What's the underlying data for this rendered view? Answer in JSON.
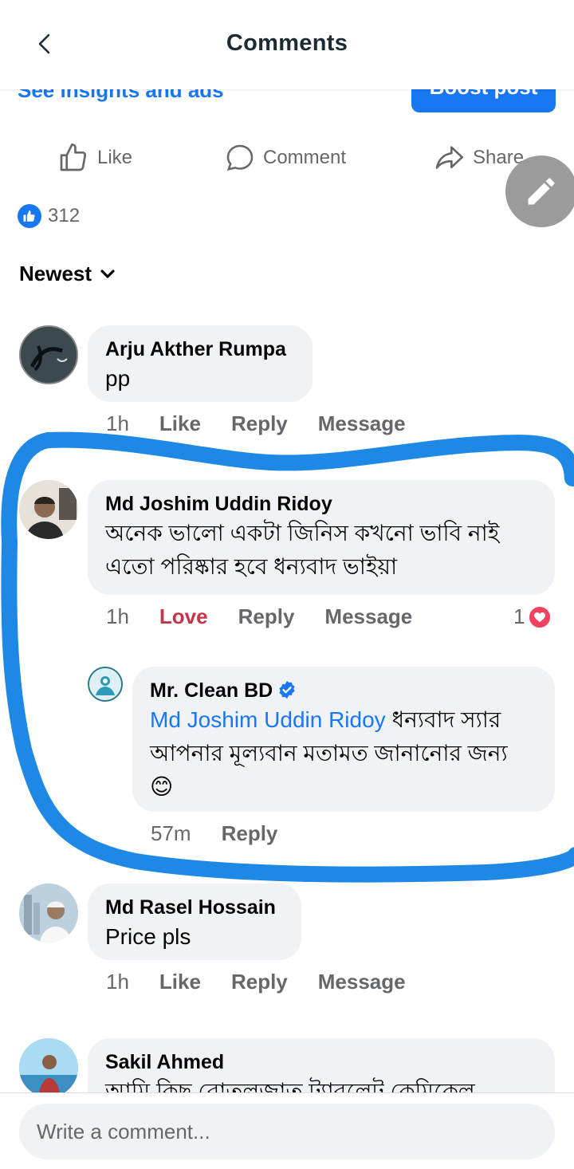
{
  "header": {
    "title": "Comments"
  },
  "post_actions": {
    "cut_link": "See insights and ads",
    "cut_button": "Boost post",
    "like": "Like",
    "comment": "Comment",
    "share": "Share"
  },
  "reactions": {
    "count": "312"
  },
  "sort": {
    "label": "Newest"
  },
  "comments": [
    {
      "author": "Arju Akther Rumpa",
      "text": "pp",
      "time": "1h",
      "like": "Like",
      "reply": "Reply",
      "message": "Message"
    },
    {
      "author": "Md Joshim Uddin Ridoy",
      "text": "অনেক ভালো একটা জিনিস কখনো ভাবি নাই এতো পরিষ্কার হবে ধন্যবাদ ভাইয়া",
      "time": "1h",
      "like": "Love",
      "reply": "Reply",
      "message": "Message",
      "reaction_count": "1",
      "reply_thread": {
        "author": "Mr. Clean BD",
        "mention": "Md Joshim Uddin Ridoy",
        "text": " ধন্যবাদ স্যার আপনার মূল্যবান মতামত জানানোর জন্য",
        "emoji": "😊",
        "time": "57m",
        "reply": "Reply"
      }
    },
    {
      "author": "Md Rasel Hossain",
      "text": "Price pls",
      "time": "1h",
      "like": "Like",
      "reply": "Reply",
      "message": "Message"
    },
    {
      "author": "Sakil Ahmed",
      "text": "আমি কিছু বোতলজাত ট্যাবলেট কেমিকেল"
    }
  ],
  "composer": {
    "placeholder": "Write a comment..."
  },
  "colors": {
    "accent": "#1877f2",
    "love": "#c5354a",
    "highlight": "#1e88e5"
  }
}
